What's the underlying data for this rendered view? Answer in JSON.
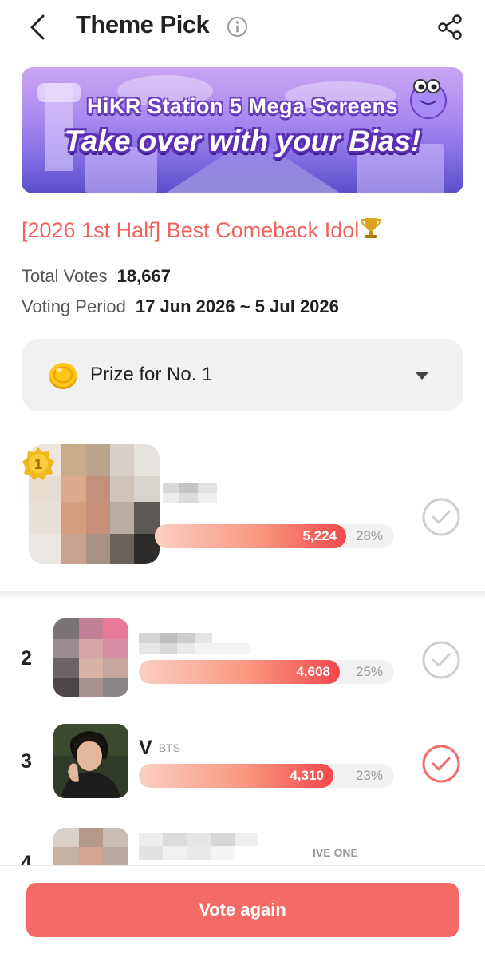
{
  "header": {
    "title": "Theme Pick"
  },
  "banner": {
    "line1": "HiKR Station 5 Mega Screens",
    "line2": "Take over with your Bias!"
  },
  "event": {
    "title": "[2026 1st Half] Best Comeback Idol",
    "total_votes_label": "Total Votes",
    "total_votes": "18,667",
    "period_label": "Voting Period",
    "period": "17 Jun 2026 ~ 5 Jul 2026"
  },
  "prize": {
    "label": "Prize for No. 1"
  },
  "rankings": [
    {
      "rank": "1",
      "name": "",
      "group": "",
      "votes": "5,224",
      "percent": "28%",
      "share": 0.28,
      "voted": false
    },
    {
      "rank": "2",
      "name": "",
      "group": "",
      "votes": "4,608",
      "percent": "25%",
      "share": 0.25,
      "voted": false
    },
    {
      "rank": "3",
      "name": "V",
      "group": "BTS",
      "votes": "4,310",
      "percent": "23%",
      "share": 0.23,
      "voted": true
    },
    {
      "rank": "4",
      "name": "",
      "group": "IVE ONE",
      "votes": "",
      "percent": "",
      "voted": false
    }
  ],
  "footer": {
    "vote_button": "Vote again"
  },
  "colors": {
    "accent": "#f46a66",
    "title_red": "#f0625c",
    "check_grey": "#cfcfcf",
    "check_active": "#f26d6d"
  }
}
